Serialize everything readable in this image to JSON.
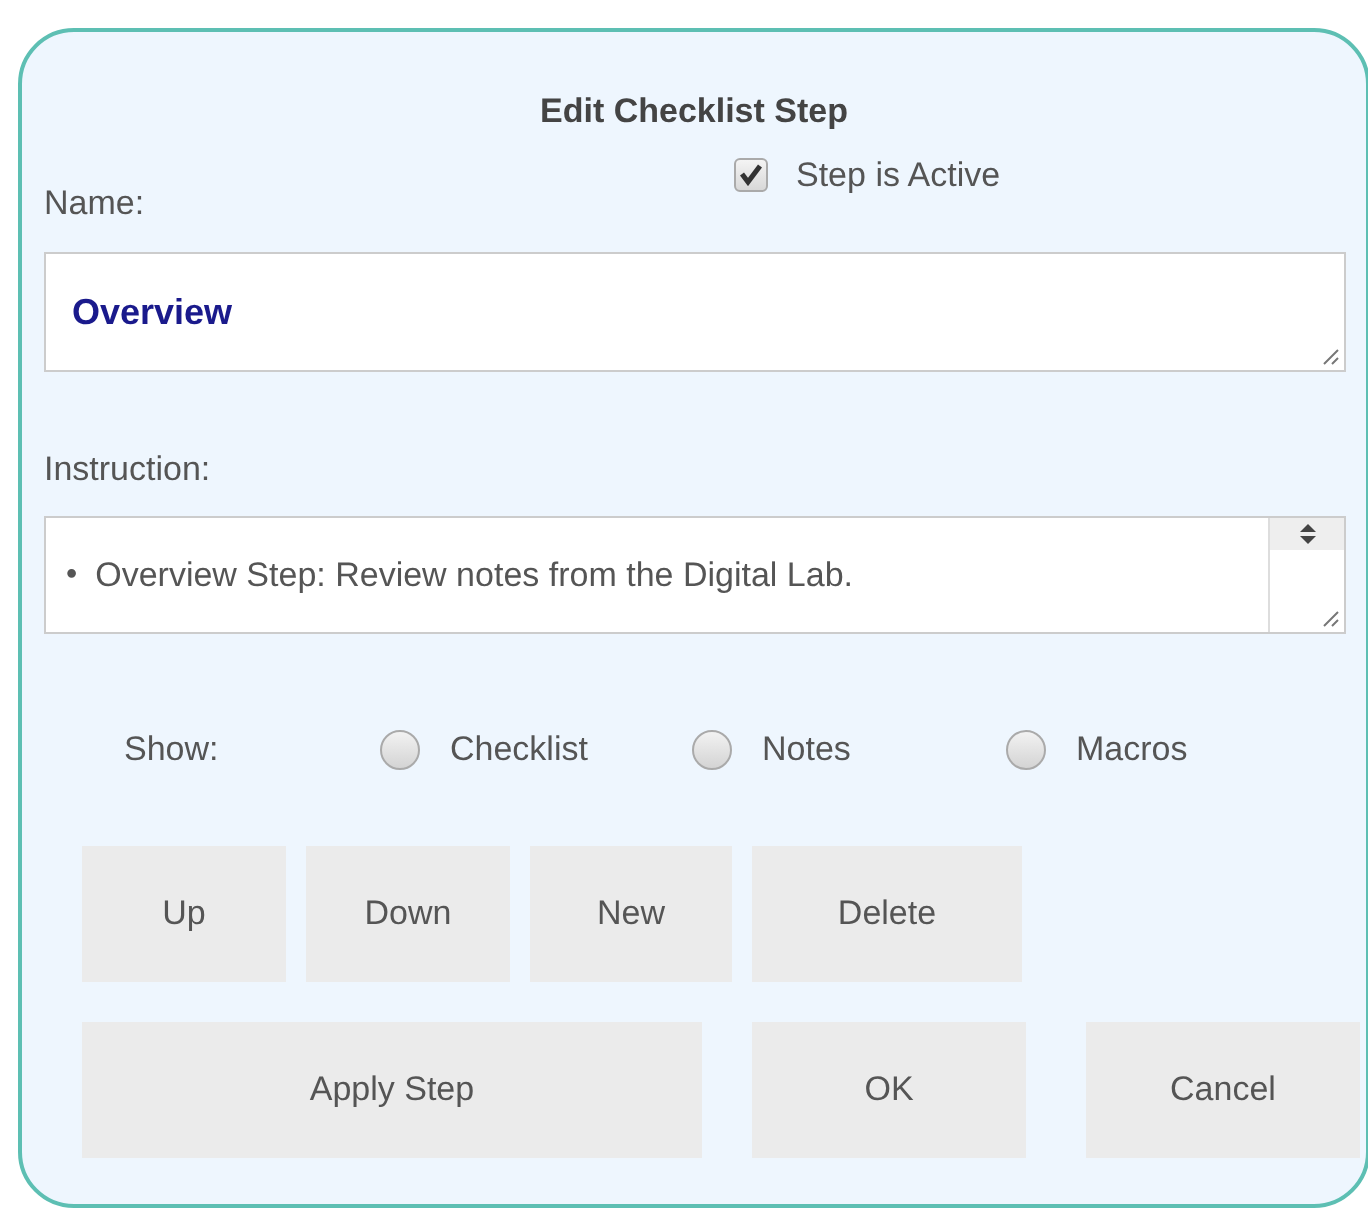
{
  "dialog": {
    "title": "Edit Checklist Step"
  },
  "name_label": "Name:",
  "active": {
    "label": "Step is Active",
    "checked": true
  },
  "name_field": {
    "value": "Overview"
  },
  "instruction_label": "Instruction:",
  "instruction_field": {
    "bullet": "•",
    "value": "Overview Step: Review notes from the Digital Lab."
  },
  "show": {
    "label": "Show:",
    "options": [
      {
        "label": "Checklist",
        "selected": false
      },
      {
        "label": "Notes",
        "selected": false
      },
      {
        "label": "Macros",
        "selected": false
      }
    ]
  },
  "step_buttons": [
    "Up",
    "Down",
    "New",
    "Delete"
  ],
  "action_buttons": [
    "Apply Step",
    "OK",
    "Cancel"
  ]
}
